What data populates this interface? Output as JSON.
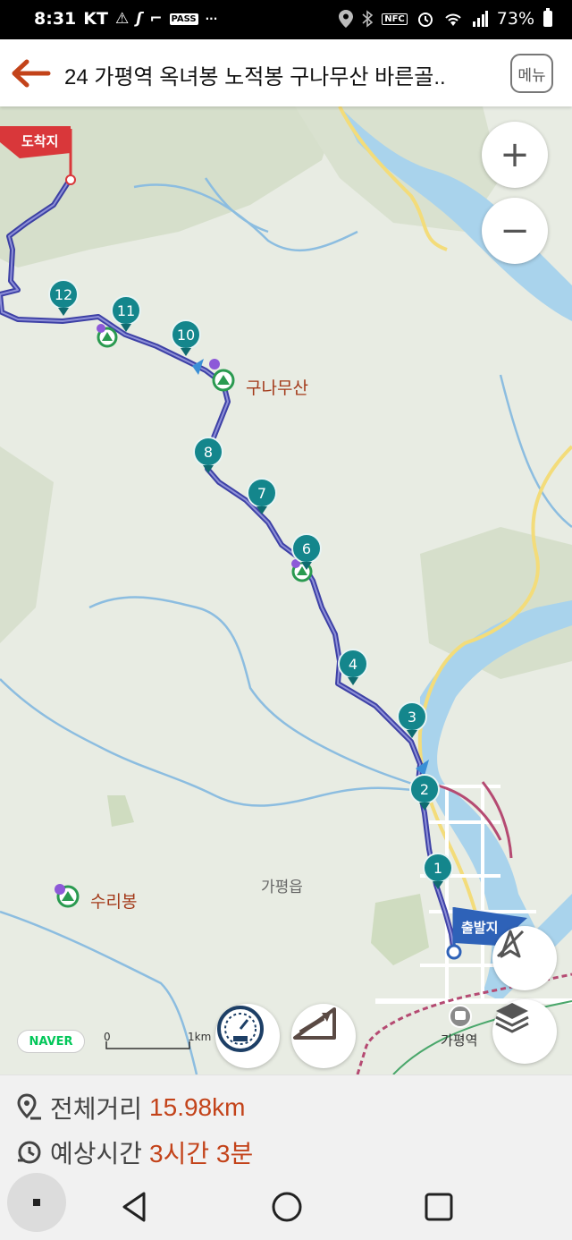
{
  "status_bar": {
    "time": "8:31",
    "carrier": "KT",
    "icons_left": [
      "warning-icon",
      "slash-icon",
      "cast-icon",
      "pass-icon",
      "more-icon"
    ],
    "pass_text": "PASS",
    "more_text": "···",
    "icons_right": [
      "location-icon",
      "bluetooth-icon",
      "nfc-icon",
      "alarm-icon",
      "wifi-icon",
      "signal-icon",
      "battery-icon"
    ],
    "nfc_text": "NFC",
    "battery": "73%"
  },
  "header": {
    "title": "24 가평역 옥녀봉 노적봉 구나무산 바른골..",
    "menu_label": "메뉴"
  },
  "map": {
    "end_flag": "도착지",
    "start_flag": "출발지",
    "peaks": [
      {
        "label": "구나무산"
      },
      {
        "label": "수리봉"
      }
    ],
    "towns": [
      {
        "label": "가평읍"
      },
      {
        "label": "가평역"
      }
    ],
    "waypoints": [
      "1",
      "2",
      "3",
      "4",
      "6",
      "7",
      "8",
      "10",
      "11",
      "12"
    ],
    "naver_logo": "NAVER",
    "scale_start": "0",
    "scale_end": "1km",
    "zoom_in": "+",
    "zoom_out": "−"
  },
  "info": {
    "distance_label": "전체거리",
    "distance_value": "15.98km",
    "time_label": "예상시간",
    "time_value": "3시간 3분"
  },
  "colors": {
    "accent": "#c3431a",
    "route": "#2b2f9e",
    "marker": "#14868c",
    "end_flag": "#d9373a",
    "start_flag": "#2e62b8"
  }
}
